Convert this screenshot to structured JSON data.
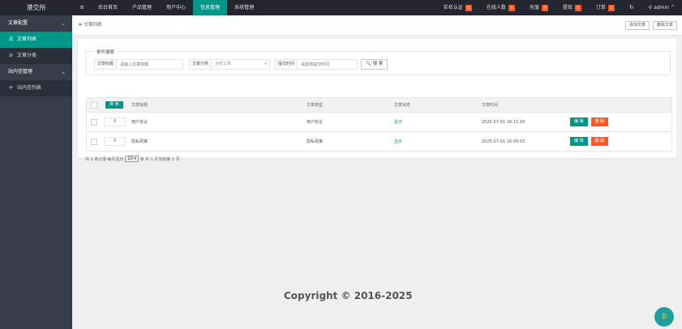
{
  "topbar": {
    "logo": "港交所",
    "menu_icon": "≡",
    "nav": [
      "后台首页",
      "产品管理",
      "用户中心",
      "信息管理",
      "系统管理"
    ],
    "active_nav": 3,
    "right": [
      {
        "label": "实名认证",
        "badge": "0"
      },
      {
        "label": "在线人数",
        "badge": "0"
      },
      {
        "label": "充值",
        "badge": "0"
      },
      {
        "label": "提现",
        "badge": "0"
      },
      {
        "label": "订单",
        "badge": "1"
      }
    ],
    "refresh_icon": "↻",
    "user_icon": "⚲",
    "user": "admin",
    "user_caret": "^"
  },
  "sidebar": {
    "groups": [
      {
        "label": "文章配置",
        "items": [
          {
            "label": "文章列表",
            "icon": "☰"
          },
          {
            "label": "文章分类",
            "icon": "⊘"
          }
        ]
      },
      {
        "label": "站内信管理",
        "items": [
          {
            "label": "站内信列表",
            "icon": "✈"
          }
        ]
      }
    ],
    "active": "文章列表"
  },
  "breadcrumb": "≫ 文章列表",
  "top_buttons": {
    "add": "添加文章",
    "delete": "删除文章"
  },
  "search": {
    "legend": "条件搜索",
    "title_label": "文章标题",
    "title_placeholder": "请输入文章标题",
    "category_label": "文章分类",
    "category_value": "全部文章",
    "date_label": "提交时间",
    "date_placeholder": "请选择提交时间",
    "button": "搜 索",
    "button_icon": "🔍"
  },
  "table": {
    "sort_button": "排 序",
    "columns": [
      "文章标题",
      "文章类型",
      "文章状态",
      "文章时间"
    ],
    "rows": [
      {
        "order": "0",
        "title": "用户协议",
        "type": "用户协议",
        "status": "显示",
        "time": "2025-07-01 16:11:29"
      },
      {
        "order": "0",
        "title": "隐私政策",
        "type": "隐私政策",
        "status": "显示",
        "time": "2025-07-01 16:09:53"
      }
    ],
    "edit_label": "编 辑",
    "delete_label": "删 除"
  },
  "pager": {
    "total": "共 2 条记录",
    "per_page_prefix": "每页显示",
    "per_page": "10",
    "per_page_suffix": "条",
    "pages": "共 1 页当前第 1 页"
  },
  "footer": {
    "copyright": "Copyright © 2016-2025"
  },
  "float_button_icon": "₿",
  "colors": {
    "primary": "#009688",
    "danger": "#ff5722",
    "topbar": "#23262e",
    "sidebar": "#393d49"
  }
}
